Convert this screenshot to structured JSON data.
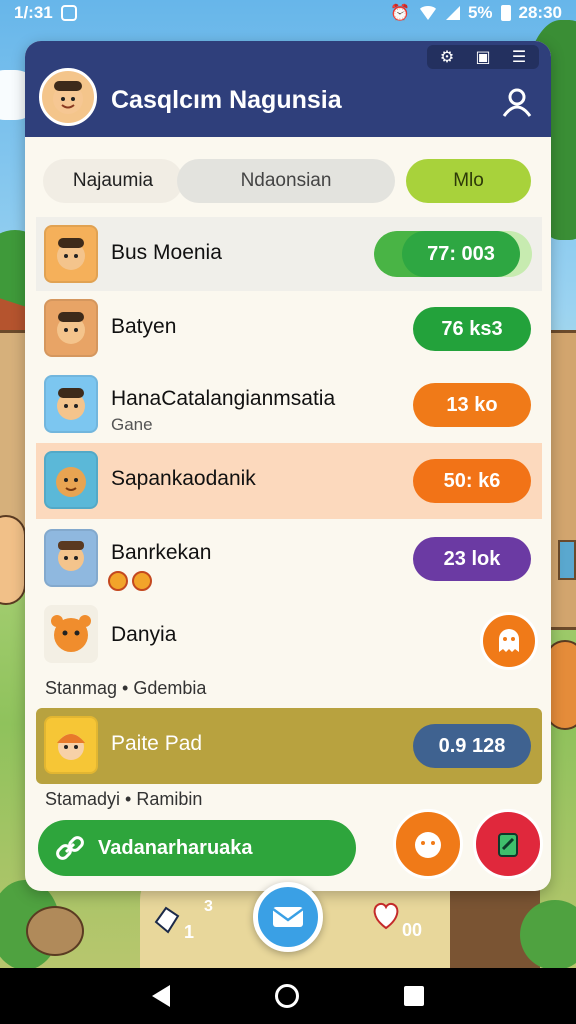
{
  "status_bar": {
    "time": "1/:31",
    "battery": "5%",
    "clock": "28:30"
  },
  "header": {
    "title": "Casqlcım Nagunsia"
  },
  "tabs": [
    {
      "label": "Najaumia"
    },
    {
      "label": "Ndaonsian"
    },
    {
      "label": "Mlo"
    }
  ],
  "list": [
    {
      "name": "Bus Moenia",
      "value": "77: 003",
      "color": "#2ea742",
      "progress": 0.45
    },
    {
      "name": "Batyen",
      "value": "76 ks3",
      "color": "#23a23b"
    },
    {
      "name": "HanaCatalangianmsatia",
      "subtitle": "Gane",
      "value": "13 ko",
      "color": "#f07a18"
    },
    {
      "name": "Sapankaodanik",
      "value": "50: k6",
      "color": "#f27317"
    },
    {
      "name": "Banrkekan",
      "value": "23 lok",
      "color": "#6b3aa3"
    },
    {
      "name": "Danyia"
    },
    {
      "name": "Paite Pad",
      "value": "0.9 128",
      "color": "#3f6290"
    }
  ],
  "sections": {
    "first": "Stanmag • Gdembia",
    "second": "Stamadyi • Ramibin"
  },
  "action_button": {
    "label": "Vadanarharuaka"
  },
  "bottom": {
    "left_count": "1",
    "left_badge": "3",
    "right_count": "00"
  },
  "colors": {
    "header": "#2f3f7b",
    "accent": "#a8d23b",
    "primary": "#2ea53c"
  }
}
